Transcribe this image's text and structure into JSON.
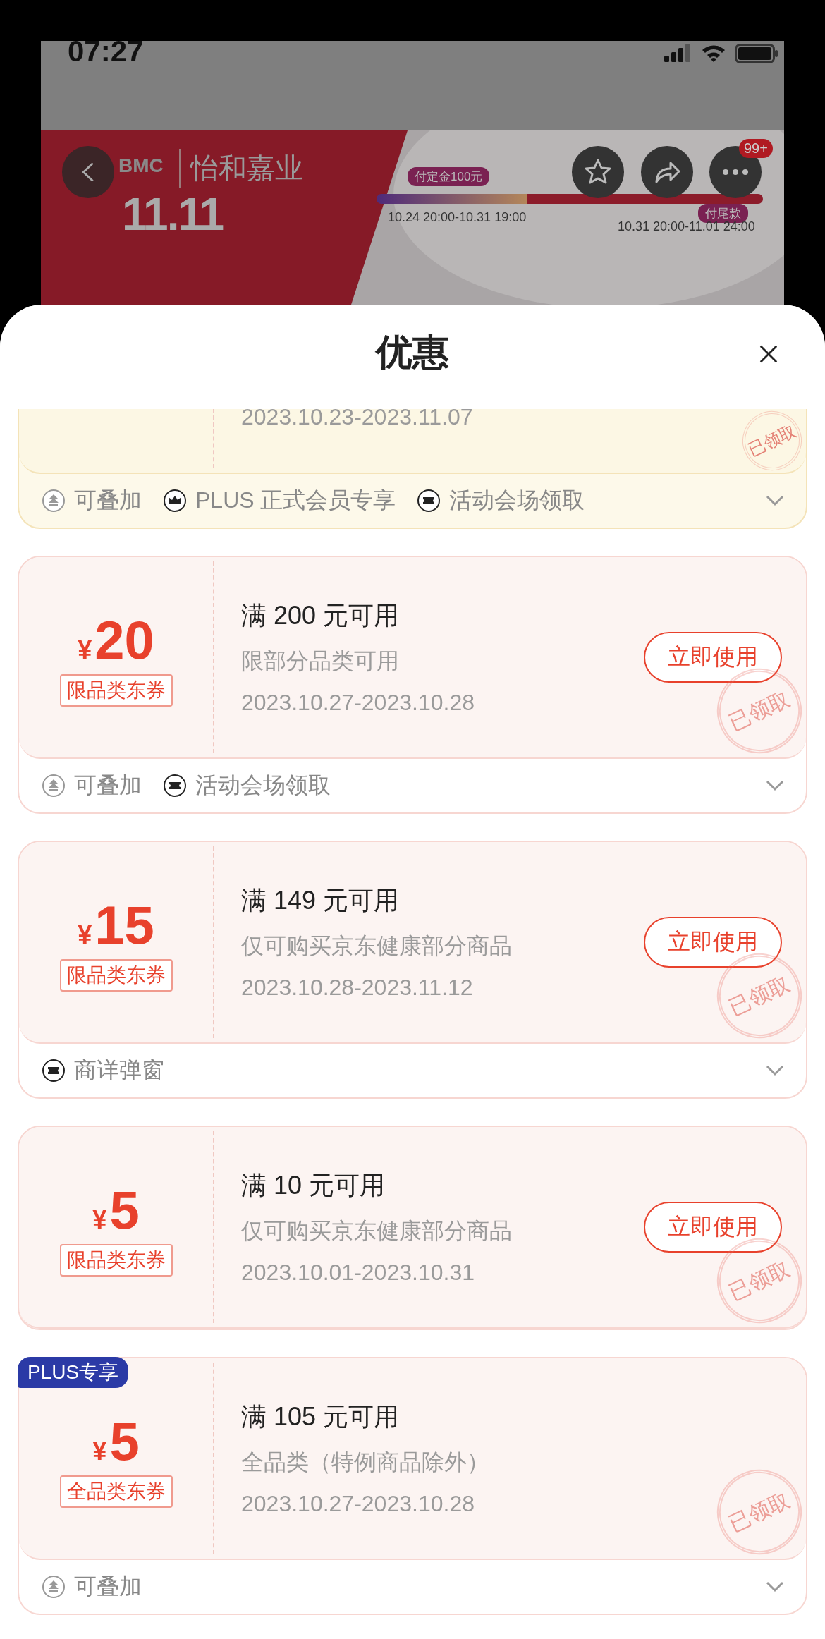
{
  "status_bar": {
    "time": "07:27"
  },
  "banner": {
    "brand_mark": "BMC",
    "brand": "怡和嘉业",
    "event": "11.11",
    "steps": [
      {
        "label": "付定金100元",
        "period": "10.24 20:00-10.31 19:00"
      },
      {
        "label": "付尾款",
        "period": "10.31 20:00-11.01 24:00"
      }
    ],
    "level": 0.39
  },
  "top_actions": {
    "more_badge": "99+"
  },
  "sheet": {
    "title": "优惠"
  },
  "coupons": [
    {
      "kind": "gold",
      "dates": "2023.10.23-2023.11.07",
      "stamp": "已领取",
      "tags": [
        {
          "kind": "stack",
          "label": "可叠加"
        },
        {
          "kind": "crown",
          "label": "PLUS 正式会员专享"
        },
        {
          "kind": "ticket",
          "label": "活动会场领取"
        }
      ],
      "expanded": false
    },
    {
      "kind": "pink",
      "currency": "¥",
      "amount": "20",
      "type": "限品类东券",
      "condition": "满 200 元可用",
      "scope": "限部分品类可用",
      "dates": "2023.10.27-2023.10.28",
      "button": "立即使用",
      "stamp": "已领取",
      "tags": [
        {
          "kind": "stack",
          "label": "可叠加"
        },
        {
          "kind": "ticket",
          "label": "活动会场领取"
        }
      ],
      "expanded": false
    },
    {
      "kind": "pink",
      "currency": "¥",
      "amount": "15",
      "type": "限品类东券",
      "condition": "满 149 元可用",
      "scope": "仅可购买京东健康部分商品",
      "dates": "2023.10.28-2023.11.12",
      "button": "立即使用",
      "stamp": "已领取",
      "tags": [
        {
          "kind": "ticket",
          "label": "商详弹窗"
        }
      ],
      "expanded": false
    },
    {
      "kind": "pink",
      "currency": "¥",
      "amount": "5",
      "type": "限品类东券",
      "condition": "满 10 元可用",
      "scope": "仅可购买京东健康部分商品",
      "dates": "2023.10.01-2023.10.31",
      "button": "立即使用",
      "stamp": "已领取"
    },
    {
      "kind": "pink",
      "badge": "PLUS专享",
      "currency": "¥",
      "amount": "5",
      "type": "全品类东券",
      "condition": "满 105 元可用",
      "scope": "全品类（特例商品除外）",
      "dates": "2023.10.27-2023.10.28",
      "stamp": "已领取",
      "tags": [
        {
          "kind": "stack",
          "label": "可叠加"
        }
      ],
      "expanded": false
    }
  ]
}
